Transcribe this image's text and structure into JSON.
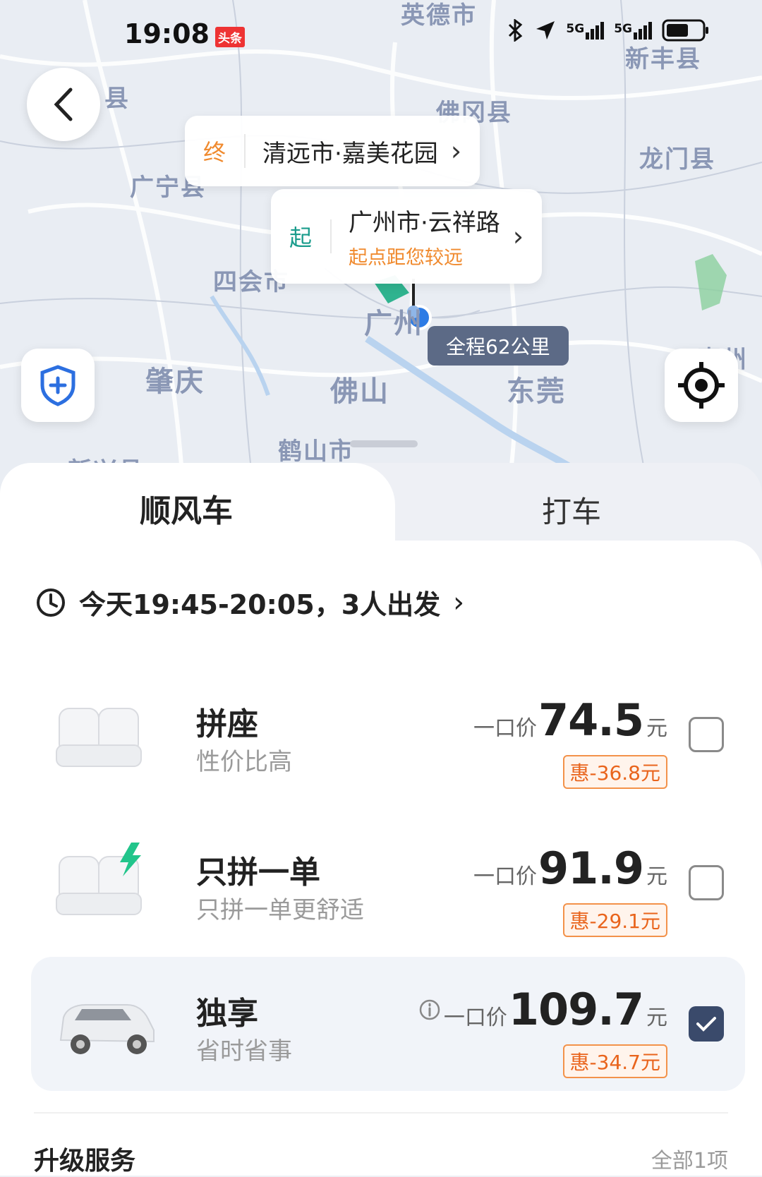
{
  "status_bar": {
    "time": "19:08",
    "badge": "头条",
    "icons": [
      "bluetooth-icon",
      "location-arrow-icon",
      "5g-signal-icon",
      "5g-signal-icon",
      "battery-icon"
    ],
    "net1": "5G",
    "net2": "5G"
  },
  "map": {
    "places": [
      "英德市",
      "新丰县",
      "佛冈县",
      "龙门县",
      "广宁县",
      "四会市",
      "肇庆",
      "佛山",
      "东莞",
      "鹤山市",
      "广州",
      "县",
      "惠州",
      "新兴县"
    ],
    "destination": {
      "tag": "终",
      "name": "清远市·嘉美花园"
    },
    "origin": {
      "tag": "起",
      "name": "广州市·云祥路",
      "note": "起点距您较远"
    },
    "distance": "全程62公里"
  },
  "tabs": [
    {
      "label": "顺风车",
      "active": true
    },
    {
      "label": "打车",
      "active": false
    }
  ],
  "schedule": "今天19:45-20:05，3人出发",
  "options": [
    {
      "title": "拼座",
      "subtitle": "性价比高",
      "price_label": "一口价",
      "price": "74.5",
      "unit": "元",
      "discount": "惠-36.8元",
      "selected": false
    },
    {
      "title": "只拼一单",
      "subtitle": "只拼一单更舒适",
      "price_label": "一口价",
      "price": "91.9",
      "unit": "元",
      "discount": "惠-29.1元",
      "selected": false
    },
    {
      "title": "独享",
      "subtitle": "省时省事",
      "price_label": "一口价",
      "price": "109.7",
      "unit": "元",
      "discount": "惠-34.7元",
      "selected": true
    }
  ],
  "upgrade": {
    "title": "升级服务",
    "all": "全部1项"
  },
  "colors": {
    "accent_orange": "#f08a2e",
    "origin_green": "#1a9c8c",
    "selected_check": "#3a4a6b",
    "shield_blue": "#2c6fe0"
  }
}
